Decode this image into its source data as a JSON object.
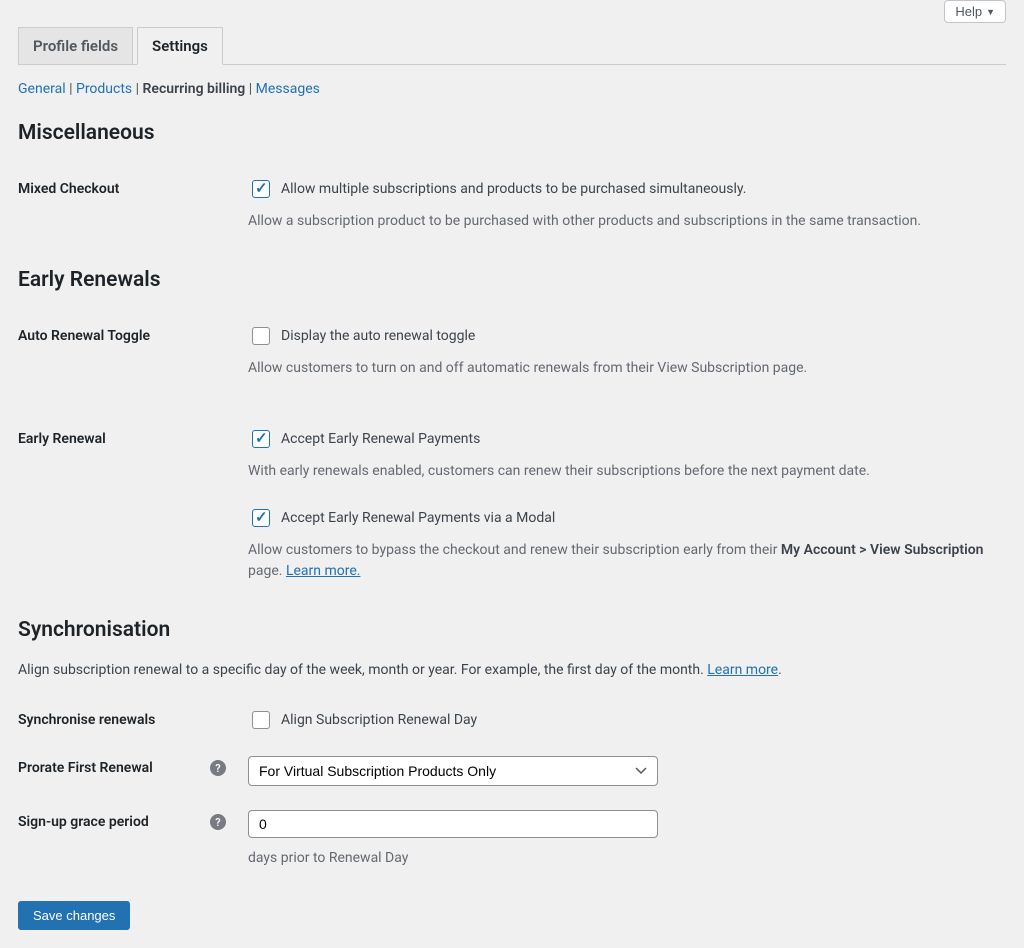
{
  "help": {
    "label": "Help"
  },
  "tabs": {
    "profile_fields": "Profile fields",
    "settings": "Settings"
  },
  "subnav": {
    "general": "General",
    "products": "Products",
    "recurring": "Recurring billing",
    "messages": "Messages"
  },
  "sections": {
    "misc": "Miscellaneous",
    "early_renewals": "Early Renewals",
    "sync": "Synchronisation"
  },
  "mixed_checkout": {
    "label": "Mixed Checkout",
    "chk": "Allow multiple subscriptions and products to be purchased simultaneously.",
    "desc": "Allow a subscription product to be purchased with other products and subscriptions in the same transaction."
  },
  "auto_renewal": {
    "label": "Auto Renewal Toggle",
    "chk": "Display the auto renewal toggle",
    "desc": "Allow customers to turn on and off automatic renewals from their View Subscription page."
  },
  "early_renewal": {
    "label": "Early Renewal",
    "chk1": "Accept Early Renewal Payments",
    "desc1": "With early renewals enabled, customers can renew their subscriptions before the next payment date.",
    "chk2": "Accept Early Renewal Payments via a Modal",
    "desc2a": "Allow customers to bypass the checkout and renew their subscription early from their ",
    "desc2b": "My Account > View Subscription",
    "desc2c": " page. ",
    "learn_more": "Learn more."
  },
  "sync": {
    "desc_a": "Align subscription renewal to a specific day of the week, month or year. For example, the first day of the month. ",
    "learn_more": "Learn more",
    "sync_renewals_label": "Synchronise renewals",
    "sync_renewals_chk": "Align Subscription Renewal Day",
    "prorate_label": "Prorate First Renewal",
    "prorate_value": "For Virtual Subscription Products Only",
    "grace_label": "Sign-up grace period",
    "grace_value": "0",
    "grace_desc": "days prior to Renewal Day"
  },
  "save": "Save changes"
}
